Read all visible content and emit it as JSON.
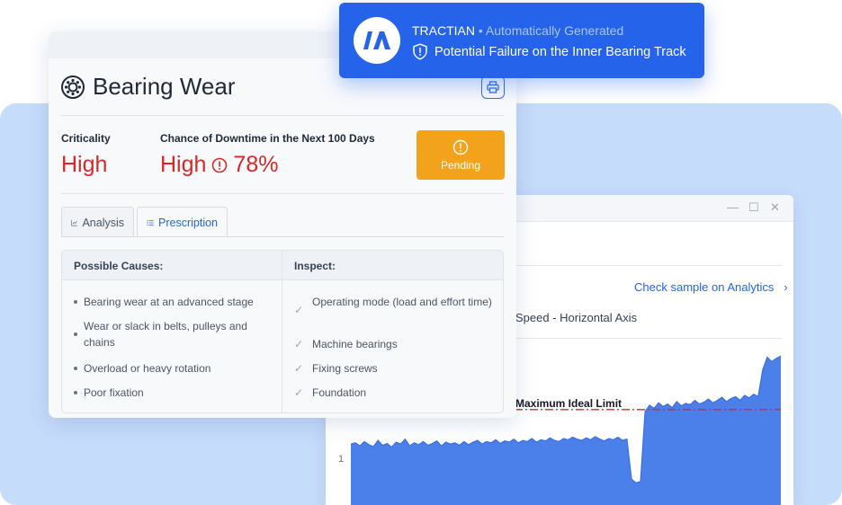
{
  "notification": {
    "brand": "TRACTIAN",
    "separator": "•",
    "subtitle": "Automatically Generated",
    "message": "Potential Failure on the Inner Bearing Track",
    "logo_text": "IA",
    "icon": "shield-alert-icon"
  },
  "card": {
    "title": "Bearing Wear",
    "title_icon": "bearing-icon",
    "print_icon": "printer-icon",
    "criticality_label": "Criticality",
    "criticality_value": "High",
    "downtime_label": "Chance of Downtime in the Next 100 Days",
    "downtime_level": "High",
    "downtime_percent": "78%",
    "status": "Pending",
    "tabs": [
      {
        "label": "Analysis",
        "icon": "chart-icon",
        "active": false
      },
      {
        "label": "Prescription",
        "icon": "list-icon",
        "active": true
      }
    ],
    "table": {
      "causes_header": "Possible Causes:",
      "inspect_header": "Inspect:",
      "causes": [
        "Bearing wear at an advanced stage",
        "Wear or slack in belts, pulleys and chains",
        "Overload or heavy rotation",
        "Poor fixation"
      ],
      "inspect": [
        "Operating mode (load and effort time)",
        "Machine bearings",
        "Fixing screws",
        "Foundation"
      ]
    }
  },
  "chart_window": {
    "link": "Check sample on Analytics",
    "axis_title": "Speed - Horizontal Axis",
    "limit_label": "Maximum Ideal Limit",
    "colors": {
      "fill": "#4b7fea",
      "limit": "#dc2626",
      "accent": "#2563eb",
      "pending": "#f2a21b"
    }
  },
  "chart_data": {
    "type": "area",
    "title": "Speed - Horizontal Axis",
    "xlabel": "",
    "ylabel": "",
    "yticks": [
      1
    ],
    "ylim": [
      0,
      2.7
    ],
    "threshold": {
      "label": "Maximum Ideal Limit",
      "value": 1.55
    },
    "grid": false,
    "x": [
      0,
      5,
      10,
      15,
      20,
      25,
      30,
      35,
      40,
      45,
      50,
      55,
      60,
      65,
      70,
      75,
      80,
      85,
      90,
      95,
      100,
      105,
      110,
      115,
      120,
      125,
      130,
      135,
      140,
      145,
      150,
      155,
      160,
      165,
      170,
      175,
      180,
      185,
      190,
      195,
      200,
      205,
      210,
      215,
      220,
      225,
      230,
      235,
      240,
      245,
      250,
      255,
      260,
      265,
      270,
      275,
      280,
      285,
      290,
      295,
      300,
      305,
      310,
      315,
      320,
      325,
      330,
      335,
      340,
      345,
      350,
      355,
      360,
      365,
      370,
      375,
      380,
      385,
      390,
      395,
      400,
      405,
      410,
      415,
      420,
      425,
      430,
      435,
      440,
      445,
      450,
      455,
      460,
      465,
      470,
      475
    ],
    "values": [
      0.99,
      1.01,
      0.96,
      1.03,
      0.98,
      0.95,
      1.05,
      0.97,
      1.0,
      0.94,
      1.02,
      0.99,
      1.07,
      0.96,
      1.01,
      0.98,
      1.03,
      0.97,
      1.0,
      1.04,
      0.96,
      1.02,
      0.99,
      1.01,
      0.97,
      1.03,
      0.98,
      1.02,
      1.05,
      0.99,
      1.03,
      1.01,
      1.06,
      1.0,
      1.04,
      1.02,
      1.07,
      1.01,
      1.05,
      1.03,
      1.08,
      1.02,
      1.06,
      1.04,
      1.09,
      1.05,
      1.03,
      1.08,
      1.06,
      1.1,
      1.07,
      1.05,
      1.09,
      1.06,
      1.11,
      1.07,
      1.04,
      1.08,
      1.06,
      1.1,
      1.05,
      1.07,
      0.42,
      0.36,
      0.38,
      1.52,
      1.62,
      1.57,
      1.66,
      1.6,
      1.64,
      1.58,
      1.68,
      1.61,
      1.65,
      1.63,
      1.7,
      1.64,
      1.67,
      1.72,
      1.66,
      1.7,
      1.75,
      1.68,
      1.73,
      1.76,
      1.7,
      1.78,
      1.74,
      1.8,
      1.76,
      2.2,
      2.4,
      2.33,
      2.38,
      2.42
    ]
  }
}
